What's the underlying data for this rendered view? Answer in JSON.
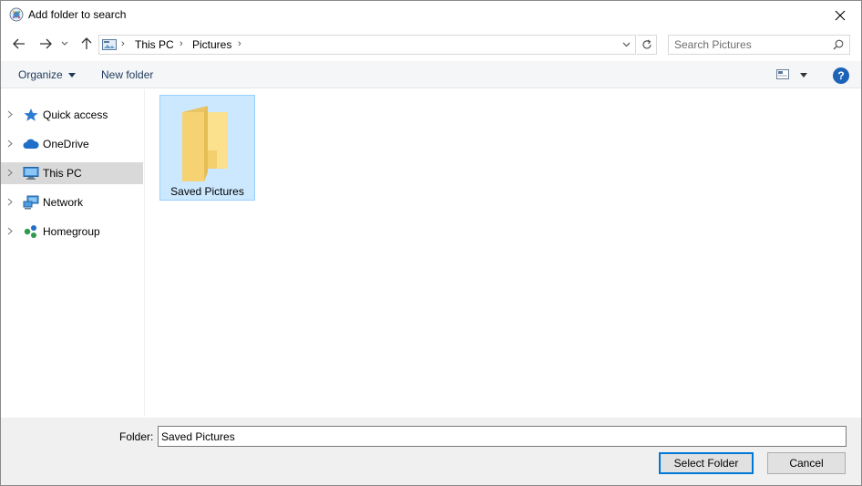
{
  "window": {
    "title": "Add folder to search"
  },
  "address": {
    "crumbs": [
      "This PC",
      "Pictures"
    ],
    "separator": "›"
  },
  "search": {
    "placeholder": "Search Pictures"
  },
  "toolbar": {
    "organize_label": "Organize",
    "new_folder_label": "New folder",
    "help_label": "?"
  },
  "sidebar": {
    "items": [
      {
        "label": "Quick access",
        "icon": "star-icon",
        "selected": false
      },
      {
        "label": "OneDrive",
        "icon": "cloud-icon",
        "selected": false
      },
      {
        "label": "This PC",
        "icon": "computer-icon",
        "selected": true
      },
      {
        "label": "Network",
        "icon": "network-icon",
        "selected": false
      },
      {
        "label": "Homegroup",
        "icon": "homegroup-icon",
        "selected": false
      }
    ]
  },
  "content": {
    "items": [
      {
        "label": "Saved Pictures",
        "icon": "folder-icon",
        "selected": true
      }
    ]
  },
  "footer": {
    "folder_label": "Folder:",
    "folder_value": "Saved Pictures",
    "select_label": "Select Folder",
    "cancel_label": "Cancel"
  },
  "colors": {
    "accent": "#0078d7",
    "selection_bg": "#cce8ff",
    "selection_border": "#99d1ff",
    "folder": "#f8d775",
    "help": "#1d63b8"
  }
}
